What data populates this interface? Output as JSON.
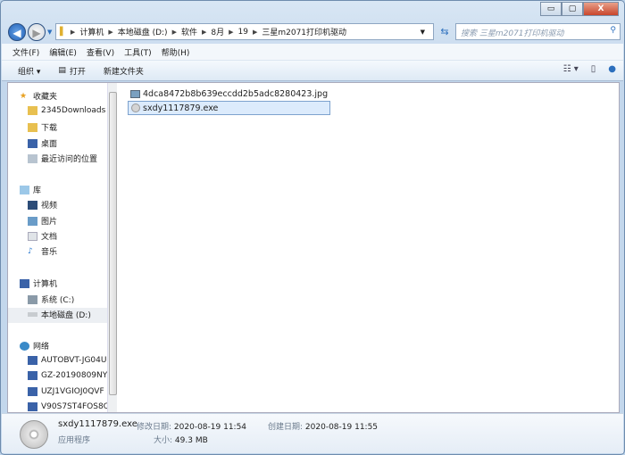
{
  "window": {
    "minimize": "▭",
    "maximize": "▢",
    "close": "X"
  },
  "address": {
    "crumbs": [
      "计算机",
      "本地磁盘 (D:)",
      "软件",
      "8月",
      "19",
      "三星m2071打印机驱动"
    ]
  },
  "search": {
    "placeholder": "搜索 三星m2071打印机驱动"
  },
  "menu": [
    "文件(F)",
    "编辑(E)",
    "查看(V)",
    "工具(T)",
    "帮助(H)"
  ],
  "toolbar": {
    "organize": "组织 ▾",
    "open": "打开",
    "new_folder": "新建文件夹"
  },
  "nav": {
    "favorites": {
      "label": "收藏夹",
      "items": [
        "2345Downloads",
        "下载",
        "桌面",
        "最近访问的位置"
      ]
    },
    "libraries": {
      "label": "库",
      "items": [
        "视频",
        "图片",
        "文档",
        "音乐"
      ]
    },
    "computer": {
      "label": "计算机",
      "items": [
        "系统 (C:)",
        "本地磁盘 (D:)"
      ]
    },
    "network": {
      "label": "网络",
      "items": [
        "AUTOBVT-JG04U",
        "GZ-20190809NY",
        "UZJ1VGIOJ0QVF",
        "V90S7ST4FOS8C"
      ]
    }
  },
  "files": [
    {
      "name": "4dca8472b8b639eccdd2b5adc8280423.jpg",
      "icon": "image-icon"
    },
    {
      "name": "sxdy1117879.exe",
      "icon": "exe-icon",
      "selected": true
    }
  ],
  "details": {
    "name": "sxdy1117879.exe",
    "type": "应用程序",
    "modified_label": "修改日期:",
    "modified": "2020-08-19 11:54",
    "created_label": "创建日期:",
    "created": "2020-08-19 11:55",
    "size_label": "大小:",
    "size": "49.3 MB"
  }
}
